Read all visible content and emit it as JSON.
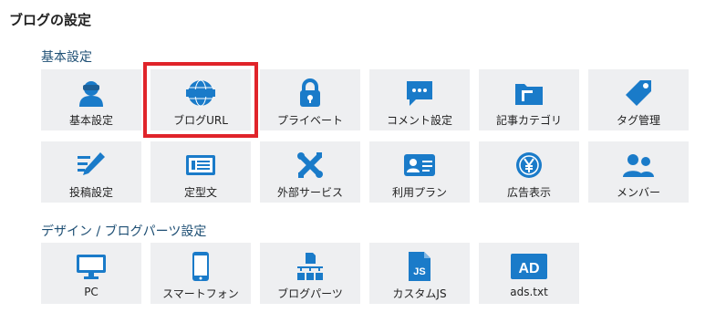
{
  "page": {
    "title": "ブログの設定"
  },
  "sections": [
    {
      "title": "基本設定",
      "items": [
        {
          "label": "基本設定",
          "icon": "user-icon",
          "selected": false
        },
        {
          "label": "ブログURL",
          "icon": "www-globe-icon",
          "selected": true
        },
        {
          "label": "プライベート",
          "icon": "lock-icon",
          "selected": false
        },
        {
          "label": "コメント設定",
          "icon": "comment-icon",
          "selected": false
        },
        {
          "label": "記事カテゴリ",
          "icon": "folder-icon",
          "selected": false
        },
        {
          "label": "タグ管理",
          "icon": "tag-icon",
          "selected": false
        },
        {
          "label": "投稿設定",
          "icon": "pencil-icon",
          "selected": false
        },
        {
          "label": "定型文",
          "icon": "template-icon",
          "selected": false
        },
        {
          "label": "外部サービス",
          "icon": "tools-icon",
          "selected": false
        },
        {
          "label": "利用プラン",
          "icon": "id-card-icon",
          "selected": false
        },
        {
          "label": "広告表示",
          "icon": "yen-coin-icon",
          "selected": false
        },
        {
          "label": "メンバー",
          "icon": "users-icon",
          "selected": false
        }
      ]
    },
    {
      "title": "デザイン / ブログパーツ設定",
      "items": [
        {
          "label": "PC",
          "icon": "monitor-icon",
          "selected": false
        },
        {
          "label": "スマートフォン",
          "icon": "smartphone-icon",
          "selected": false
        },
        {
          "label": "ブログパーツ",
          "icon": "blog-parts-icon",
          "selected": false
        },
        {
          "label": "カスタムJS",
          "icon": "js-file-icon",
          "icon_text": "JS",
          "selected": false
        },
        {
          "label": "ads.txt",
          "icon": "ad-icon",
          "icon_text": "AD",
          "selected": false
        }
      ]
    }
  ],
  "colors": {
    "accent": "#1a7bc9",
    "tile_bg": "#eeeff1",
    "highlight": "#e0242a",
    "section_title": "#1e4f74"
  }
}
